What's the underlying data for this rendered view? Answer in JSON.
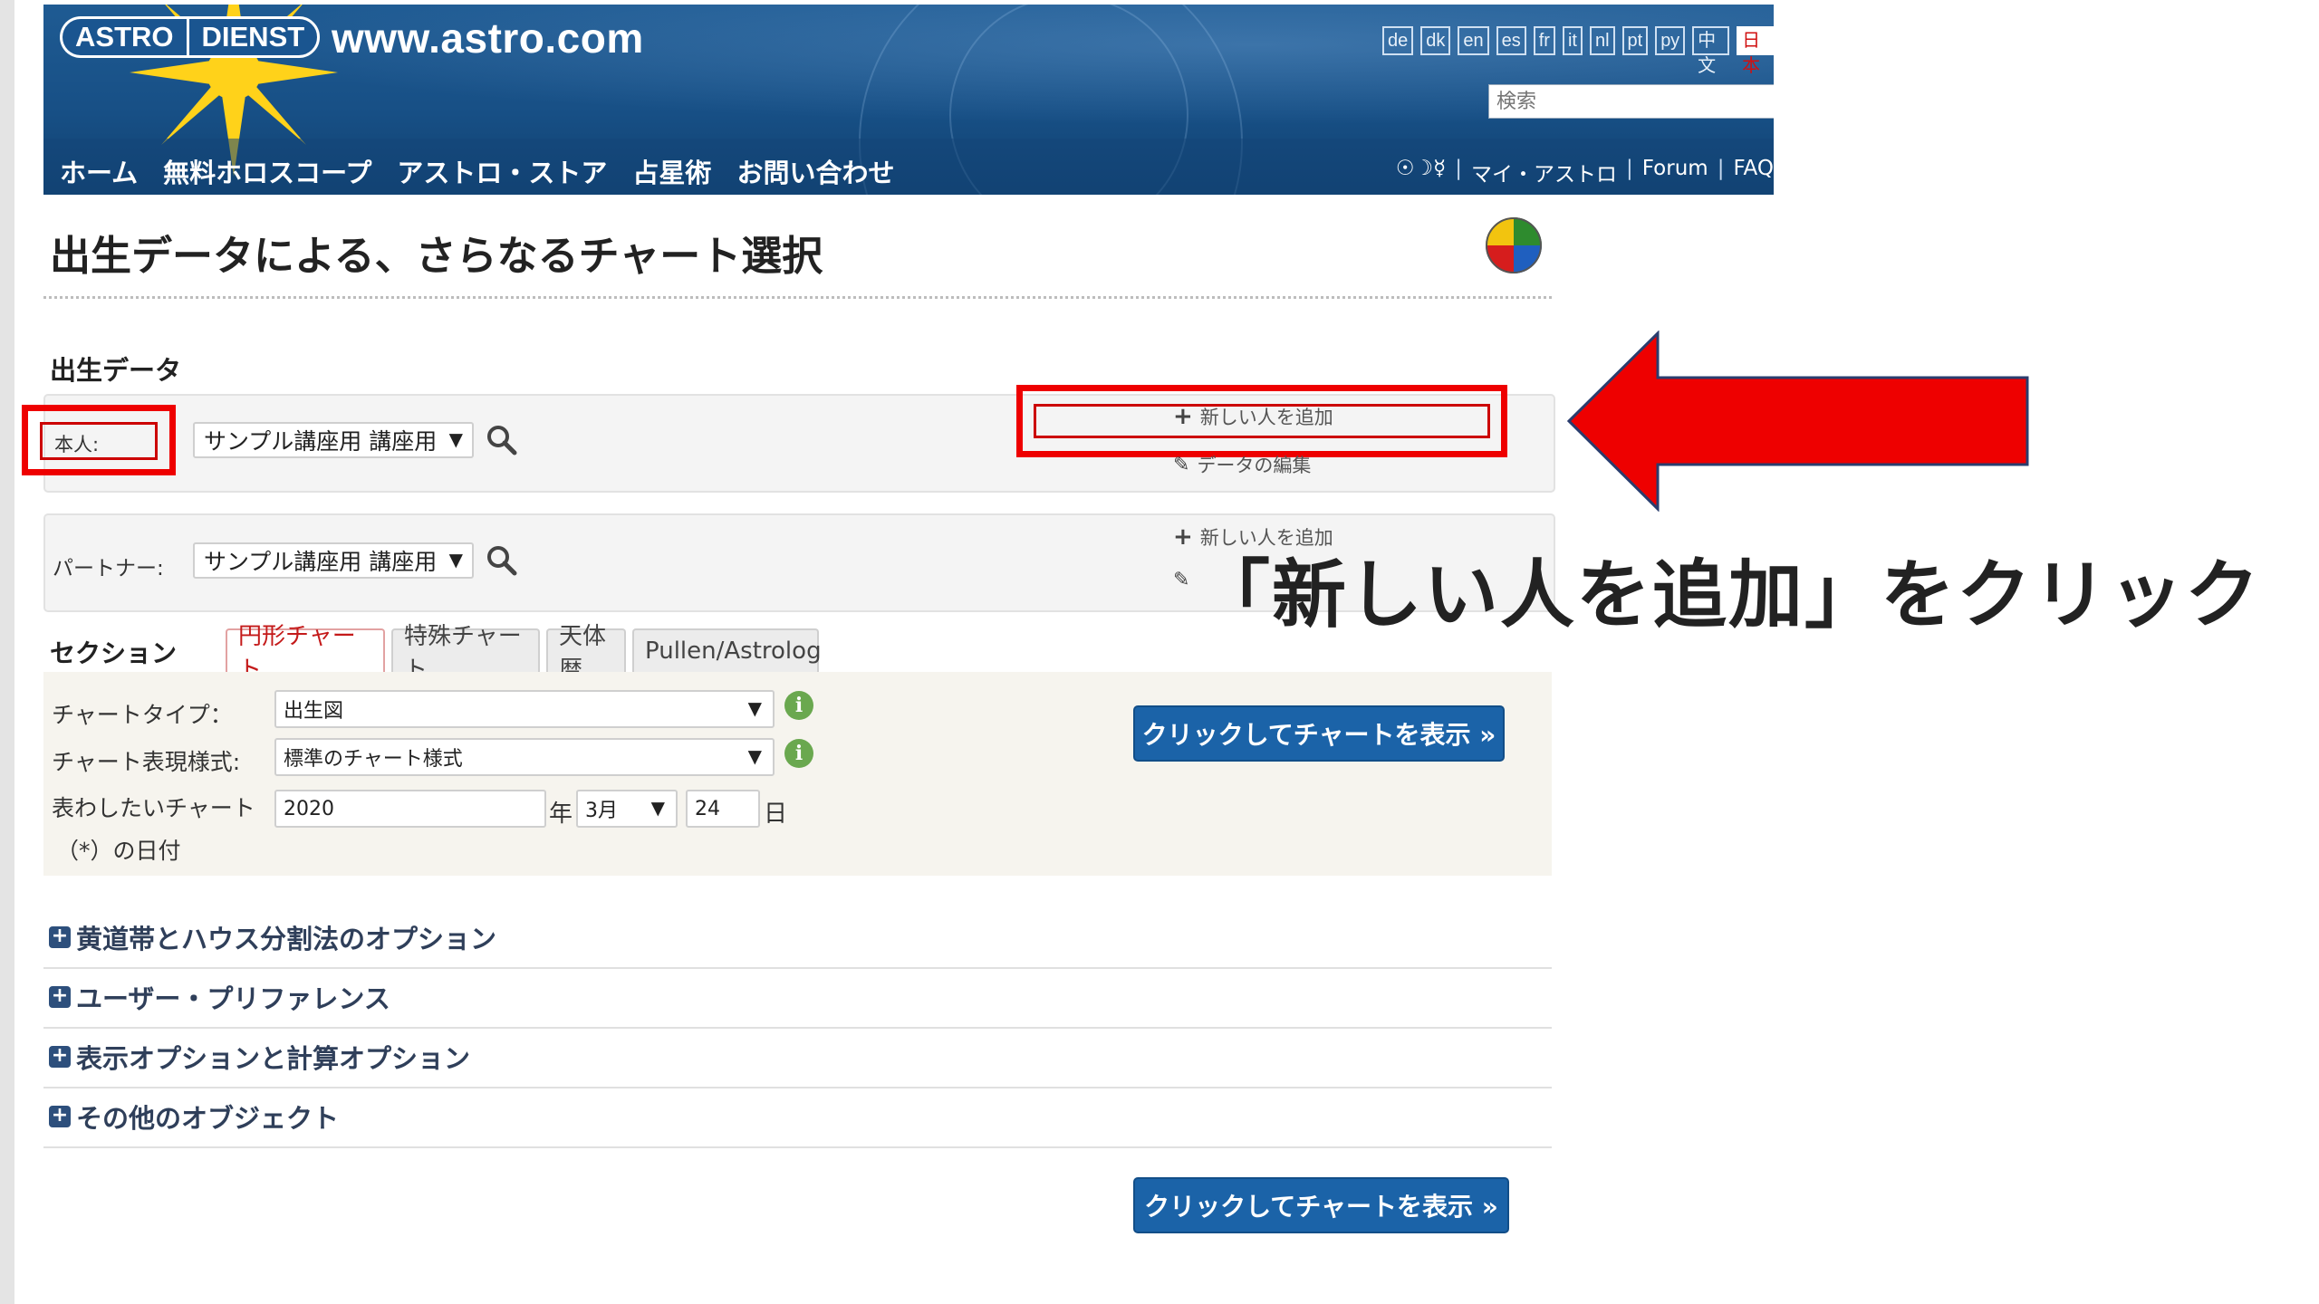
{
  "header": {
    "logo_left": "ASTRO",
    "logo_right": "DIENST",
    "site_url": "www.astro.com",
    "languages": [
      "de",
      "dk",
      "en",
      "es",
      "fr",
      "it",
      "nl",
      "pt",
      "ру",
      "中文",
      "日本"
    ],
    "active_language": "日本",
    "search_placeholder": "検索",
    "nav": [
      "ホーム",
      "無料ホロスコープ",
      "アストロ・ストア",
      "占星術",
      "お問い合わせ"
    ],
    "nav_right": {
      "symbols": "☉☽☿",
      "my_astro": "マイ・アストロ",
      "forum": "Forum",
      "faq": "FAQ"
    }
  },
  "page": {
    "title": "出生データによる、さらなるチャート選択",
    "birth_data_heading": "出生データ"
  },
  "person": {
    "label": "本人:",
    "selected": "サンプル講座用 講座用",
    "add_new": "新しい人を追加",
    "edit_data": "データの編集"
  },
  "partner": {
    "label": "パートナー:",
    "selected": "サンプル講座用 講座用",
    "add_new": "新しい人を追加"
  },
  "section": {
    "label": "セクション",
    "tabs": [
      "円形チャート",
      "特殊チャート",
      "天体暦",
      "Pullen/Astrolog"
    ],
    "active_tab": 0
  },
  "chart_form": {
    "chart_type_label": "チャートタイプ：",
    "chart_type_value": "出生図",
    "chart_style_label": "チャート表現様式:",
    "chart_style_value": "標準のチャート様式",
    "date_label_line1": "表わしたいチャート",
    "date_label_line2": "（*）の日付",
    "year": "2020",
    "year_unit": "年",
    "month": "3月",
    "day": "24",
    "day_unit": "日",
    "show_chart_button": "クリックしてチャートを表示 »"
  },
  "accordions": [
    "黄道帯とハウス分割法のオプション",
    "ユーザー・プリファレンス",
    "表示オプションと計算オプション",
    "その他のオブジェクト"
  ],
  "bottom_button": "クリックしてチャートを表示 »",
  "annotation": {
    "text": "「新しい人を追加」をクリック",
    "highlight_color": "#ee0000"
  }
}
